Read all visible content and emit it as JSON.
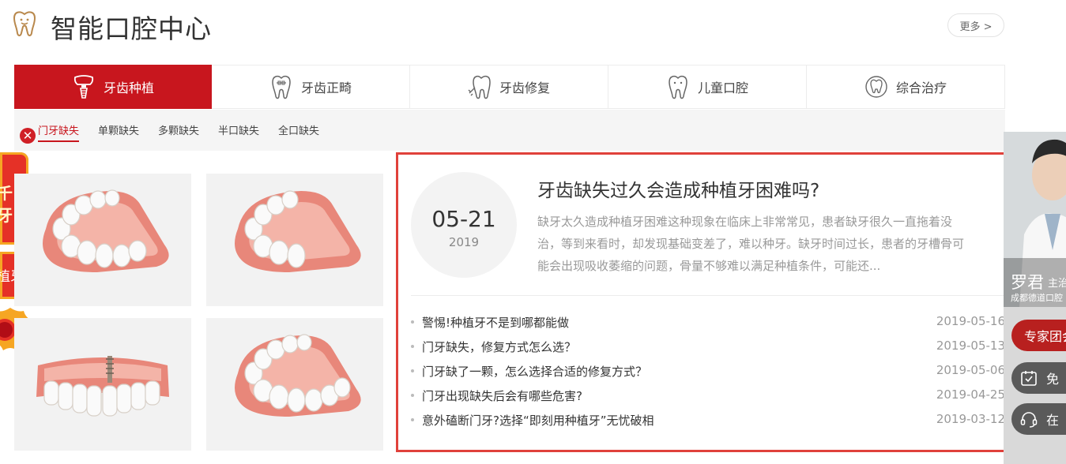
{
  "header": {
    "title": "智能口腔中心",
    "more_label": "更多 >"
  },
  "tabs": [
    {
      "label": "牙齿种植",
      "active": true,
      "icon": "implant-tooth-icon"
    },
    {
      "label": "牙齿正畸",
      "active": false,
      "icon": "braces-tooth-icon"
    },
    {
      "label": "牙齿修复",
      "active": false,
      "icon": "repair-tooth-icon"
    },
    {
      "label": "儿童口腔",
      "active": false,
      "icon": "child-tooth-icon"
    },
    {
      "label": "综合治疗",
      "active": false,
      "icon": "care-tooth-icon"
    }
  ],
  "subtabs": [
    {
      "label": "门牙缺失",
      "active": true
    },
    {
      "label": "单颗缺失",
      "active": false
    },
    {
      "label": "多颗缺失",
      "active": false
    },
    {
      "label": "半口缺失",
      "active": false
    },
    {
      "label": "全口缺失",
      "active": false
    }
  ],
  "left_decor": {
    "badge1_line1": "千",
    "badge1_line2": "牙",
    "badge2": "植牙"
  },
  "featured": {
    "date_md": "05-21",
    "year": "2019",
    "title": "牙齿缺失过久会造成种植牙困难吗?",
    "summary": "缺牙太久造成种植牙困难这种现象在临床上非常常见，患者缺牙很久一直拖着没治，等到来看时，却发现基础变差了，难以种牙。缺牙时间过长，患者的牙槽骨可能会出现吸收萎缩的问题，骨量不够难以满足种植条件，可能还..."
  },
  "news": [
    {
      "title": "警惕!种植牙不是到哪都能做",
      "date": "2019-05-16"
    },
    {
      "title": "门牙缺失，修复方式怎么选？",
      "date": "2019-05-13"
    },
    {
      "title": "门牙缺了一颗，怎么选择合适的修复方式？",
      "date": "2019-05-06"
    },
    {
      "title": "门牙出现缺失后会有哪些危害?",
      "date": "2019-04-25"
    },
    {
      "title": "意外磕断门牙?选择“即刻用种植牙”无忧破相",
      "date": "2019-03-12"
    }
  ],
  "sidebar": {
    "doctor_name": "罗君",
    "doctor_role": "主治",
    "hospital": "成都德道口腔",
    "btn_team": "专家团会",
    "btn_free": "免",
    "btn_online": "在"
  },
  "colors": {
    "brand_red": "#c8161e",
    "highlight_border": "#e0413b",
    "gum_pink": "#e8877a"
  }
}
